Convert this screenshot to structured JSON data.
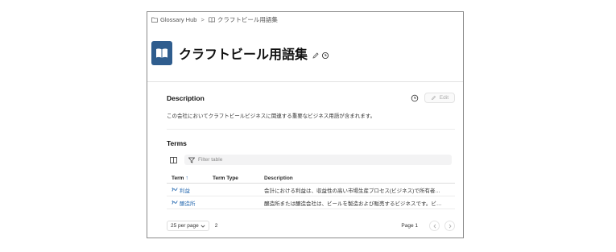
{
  "breadcrumb": {
    "root": "Glossary Hub",
    "separator": ">",
    "current": "クラフトビール用語集"
  },
  "header": {
    "title": "クラフトビール用語集",
    "tile_color": "#2f5d8e",
    "icons": [
      "book-icon",
      "pencil-icon",
      "clock-icon"
    ]
  },
  "description": {
    "title": "Description",
    "edit_label": "Edit",
    "text": "この会社においてクラフトビールビジネスに関連する重要なビジネス用語が含まれます。"
  },
  "terms": {
    "title": "Terms",
    "filter_placeholder": "Filter table",
    "columns": [
      "Term",
      "Term Type",
      "Description"
    ],
    "sort_indicator": "↑",
    "rows": [
      {
        "term": "利益",
        "type": "",
        "description": "会計における利益は、収益性の高い市場生産プロセス(ビジネス)で所有者…"
      },
      {
        "term": "醸造所",
        "type": "",
        "description": "醸造所または醸造会社は、ビールを製造および販売するビジネスです。ビ…"
      }
    ]
  },
  "pagination": {
    "per_page": "25 per page",
    "count": "2",
    "page": "Page 1"
  },
  "colors": {
    "accent": "#2f6fb3",
    "frame_border": "#8a8a8a"
  }
}
